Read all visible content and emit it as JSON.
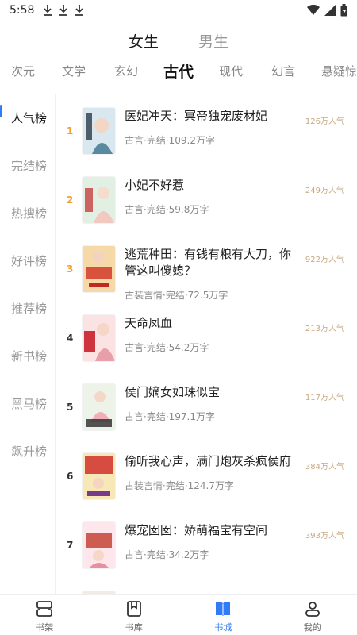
{
  "status_bar": {
    "time": "5:58",
    "download_icons": [
      "download-icon",
      "download-icon",
      "download-icon"
    ],
    "right_icons": [
      "wifi-icon",
      "signal-icon",
      "battery-icon"
    ]
  },
  "gender_tabs": [
    {
      "label": "女生",
      "active": true
    },
    {
      "label": "男生",
      "active": false
    }
  ],
  "category_tabs": [
    {
      "label": "次元",
      "active": false
    },
    {
      "label": "文学",
      "active": false
    },
    {
      "label": "玄幻",
      "active": false
    },
    {
      "label": "古代",
      "active": true
    },
    {
      "label": "现代",
      "active": false
    },
    {
      "label": "幻言",
      "active": false
    },
    {
      "label": "悬疑惊悚",
      "active": false
    }
  ],
  "sidebar": [
    {
      "label": "人气榜",
      "active": true
    },
    {
      "label": "完结榜",
      "active": false
    },
    {
      "label": "热搜榜",
      "active": false
    },
    {
      "label": "好评榜",
      "active": false
    },
    {
      "label": "推荐榜",
      "active": false
    },
    {
      "label": "新书榜",
      "active": false
    },
    {
      "label": "黑马榜",
      "active": false
    },
    {
      "label": "飙升榜",
      "active": false
    }
  ],
  "books": [
    {
      "rank": "1",
      "title": "医妃冲天：冥帝独宠废材妃",
      "meta": "古言·完结·109.2万字",
      "popularity": "126万人气",
      "cover_color": "#d8e8ee",
      "cover_accent": "#5a8aa0"
    },
    {
      "rank": "2",
      "title": "小妃不好惹",
      "meta": "古言·完结·59.8万字",
      "popularity": "249万人气",
      "cover_color": "#e2f0e4",
      "cover_accent": "#c84a4a"
    },
    {
      "rank": "3",
      "title": "逃荒种田：有钱有粮有大刀，你管这叫傻媳？",
      "meta": "古装言情·完结·72.5万字",
      "popularity": "922万人气",
      "cover_color": "#f6d9a8",
      "cover_accent": "#d23a2a"
    },
    {
      "rank": "4",
      "title": "天命凤血",
      "meta": "古言·完结·54.2万字",
      "popularity": "213万人气",
      "cover_color": "#fbe3e3",
      "cover_accent": "#c8202a"
    },
    {
      "rank": "5",
      "title": "侯门嫡女如珠似宝",
      "meta": "古言·完结·197.1万字",
      "popularity": "117万人气",
      "cover_color": "#eef3ea",
      "cover_accent": "#2a2a2a"
    },
    {
      "rank": "6",
      "title": "偷听我心声，满门炮灰杀疯侯府",
      "meta": "古装言情·完结·124.7万字",
      "popularity": "384万人气",
      "cover_color": "#f7e8b8",
      "cover_accent": "#d0302a"
    },
    {
      "rank": "7",
      "title": "爆宠囡囡：娇萌福宝有空间",
      "meta": "古言·完结·34.2万字",
      "popularity": "393万人气",
      "cover_color": "#fde6ec",
      "cover_accent": "#c0392b"
    }
  ],
  "bottom_nav": [
    {
      "label": "书架",
      "icon": "bookshelf-icon",
      "active": false
    },
    {
      "label": "书库",
      "icon": "library-icon",
      "active": false
    },
    {
      "label": "书城",
      "icon": "bookstore-icon",
      "active": true
    },
    {
      "label": "我的",
      "icon": "profile-icon",
      "active": false
    }
  ],
  "colors": {
    "accent": "#2f7cf6",
    "rank_top": "#f0a030",
    "popularity": "#c8a882"
  }
}
